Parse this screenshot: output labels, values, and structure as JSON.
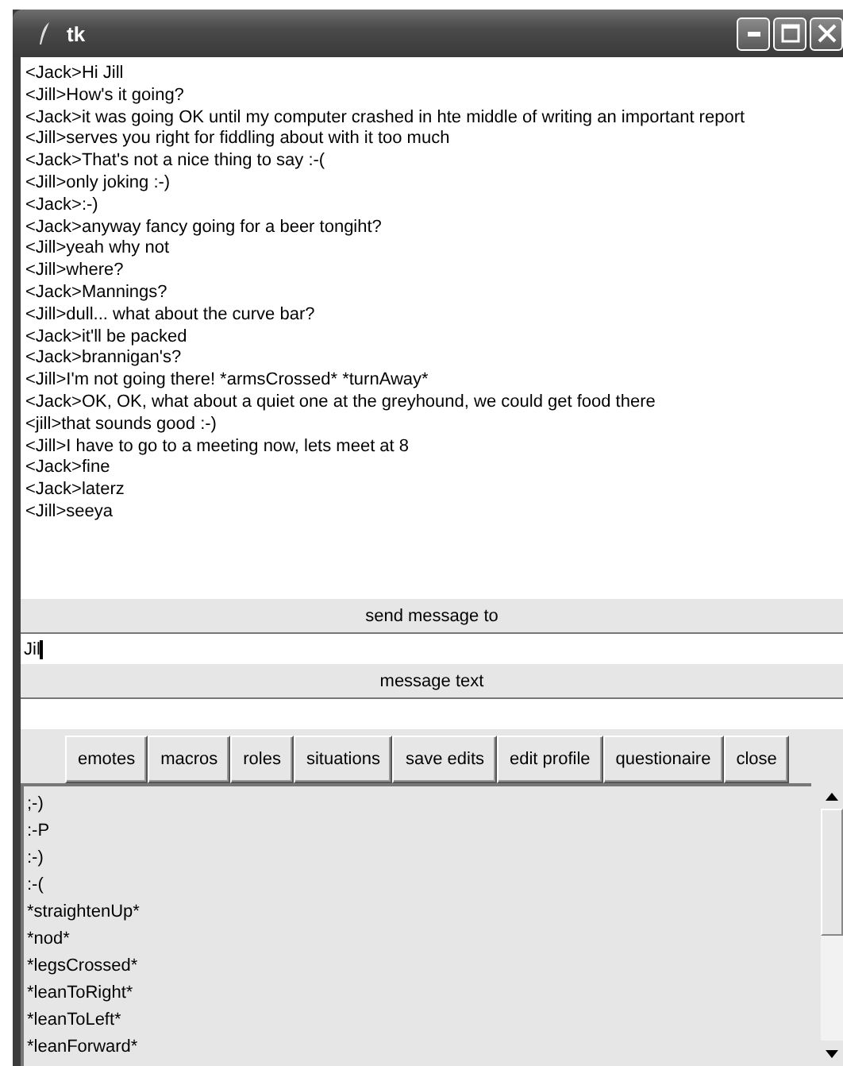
{
  "window": {
    "title": "tk"
  },
  "chat": {
    "lines": [
      "<Jack>Hi Jill",
      "<Jill>How's it going?",
      "<Jack>it was going OK until my computer crashed in hte middle of writing an important report",
      "<Jill>serves you right for fiddling about with it too much",
      "<Jack>That's not a nice thing to say :-(",
      "<Jill>only joking :-)",
      "<Jack>:-)",
      "<Jack>anyway fancy going for a beer tongiht?",
      "<Jill>yeah why not",
      "<Jill>where?",
      "<Jack>Mannings?",
      "<Jill>dull... what about the curve bar?",
      "<Jack>it'll be packed",
      "<Jack>brannigan's?",
      "<Jill>I'm not going there! *armsCrossed* *turnAway*",
      "<Jack>OK, OK, what about a quiet one at the greyhound, we could get food there",
      "<jill>that sounds good :-)",
      "<Jill>I have to go to a meeting now, lets meet at 8",
      "<Jack>fine",
      "<Jack>laterz",
      "<Jill>seeya"
    ]
  },
  "recipient": {
    "label": "send message to",
    "value": "Jil"
  },
  "message": {
    "label": "message text"
  },
  "buttons": [
    "emotes",
    "macros",
    "roles",
    "situations",
    "save edits",
    "edit profile",
    "questionaire",
    "close"
  ],
  "list": {
    "items": [
      ";-)",
      ":-P",
      ":-)",
      ":-(",
      "*straightenUp*",
      "*nod*",
      "*legsCrossed*",
      "*leanToRight*",
      "*leanToLeft*",
      "*leanForward*"
    ]
  }
}
